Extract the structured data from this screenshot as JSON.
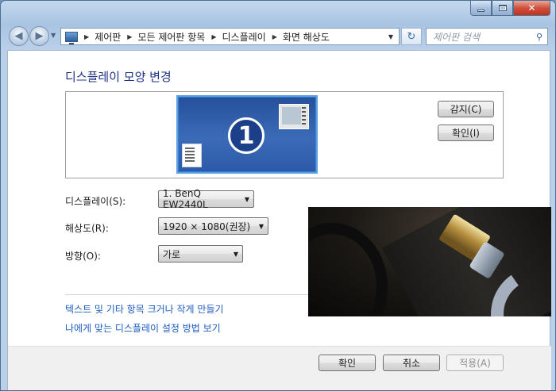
{
  "window": {
    "caption": {
      "minimize": "",
      "maximize": "",
      "close": "✕"
    }
  },
  "nav": {
    "back_glyph": "◀",
    "forward_glyph": "▶",
    "breadcrumb": [
      "제어판",
      "모든 제어판 항목",
      "디스플레이",
      "화면 해상도"
    ],
    "search_placeholder": "제어판 검색",
    "refresh_glyph": "↻"
  },
  "page": {
    "title": "디스플레이 모양 변경",
    "monitor_number": "1",
    "buttons": {
      "detect": "감지(C)",
      "identify": "확인(I)",
      "ok": "확인",
      "cancel": "취소",
      "apply": "적용(A)"
    },
    "fields": {
      "display_label": "디스플레이(S):",
      "display_value": "1. BenQ EW2440L",
      "resolution_label": "해상도(R):",
      "resolution_value": "1920 × 1080(권장)",
      "orientation_label": "방향(O):",
      "orientation_value": "가로"
    },
    "links": {
      "text_size": "텍스트 및 기타 항목 크거나 작게 만들기",
      "help": "나에게 맞는 디스플레이 설정 방법 보기"
    }
  },
  "colors": {
    "title": "#1e3287",
    "link": "#1e5ebf",
    "monitor_selected": "#2f85d6"
  }
}
